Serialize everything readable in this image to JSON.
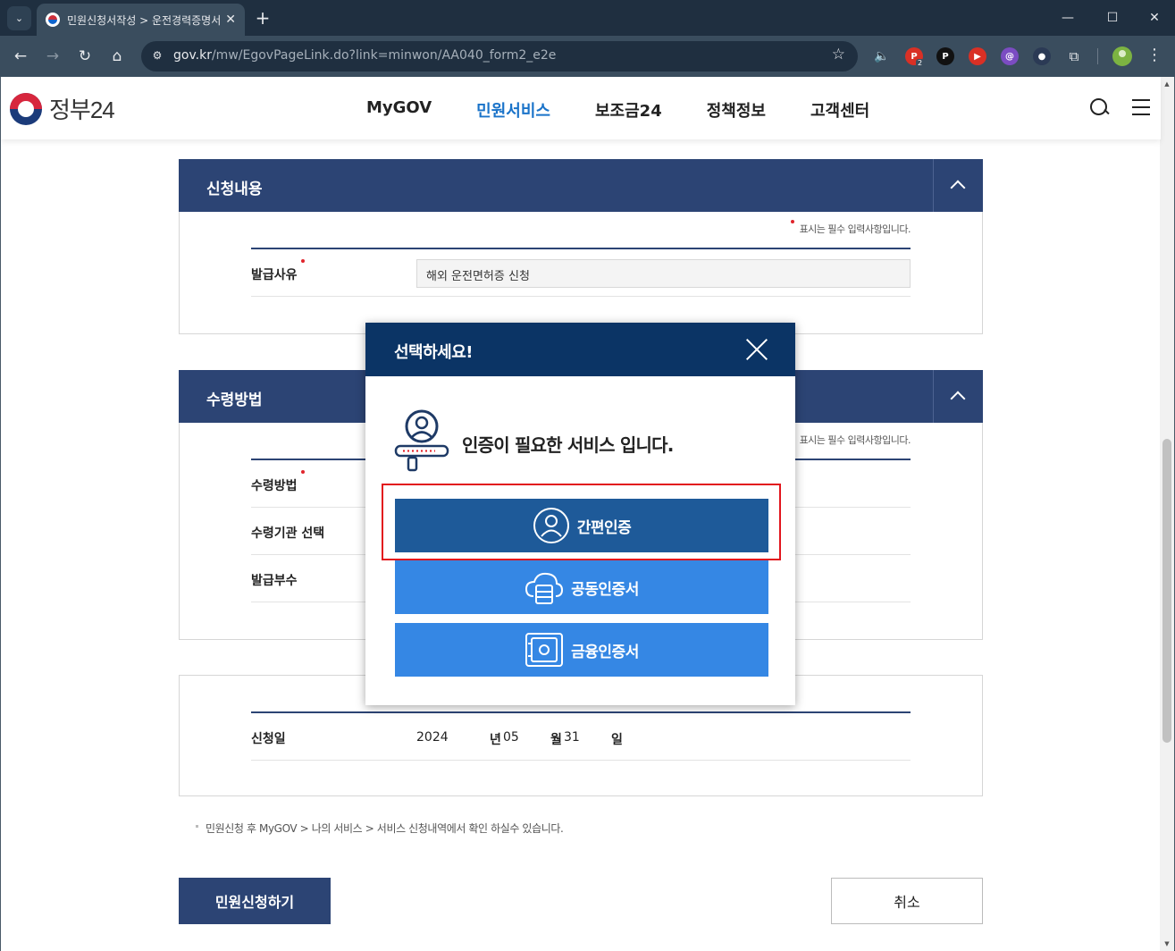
{
  "browser": {
    "tab_title": "민원신청서작성 > 운전경력증명서",
    "url_domain": "gov.kr",
    "url_path": "/mw/EgovPageLink.do?link=minwon/AA040_form2_e2e",
    "extensions": [
      {
        "name": "ext-p-icon",
        "letter": "P",
        "color": "#d93025",
        "badge": "2"
      },
      {
        "name": "ext-pocket-icon",
        "letter": "P",
        "color": "#111111",
        "badge": ""
      },
      {
        "name": "ext-youtube-icon",
        "letter": "▶",
        "color": "#d93025",
        "badge": ""
      },
      {
        "name": "ext-purple-icon",
        "letter": "@",
        "color": "#7b4cc2",
        "badge": ""
      },
      {
        "name": "ext-color-icon",
        "letter": "●",
        "color": "#2b3a55",
        "badge": ""
      }
    ]
  },
  "header": {
    "logo_text": "정부24",
    "nav": [
      "MyGOV",
      "민원서비스",
      "보조금24",
      "정책정보",
      "고객센터"
    ],
    "active_nav": "민원서비스"
  },
  "section1": {
    "title": "신청내용",
    "required_note": "표시는 필수 입력사항입니다.",
    "reason_label": "발급사유",
    "reason_value": "해외 운전면허증 신청"
  },
  "section2": {
    "title": "수령방법",
    "required_note": "표시는 필수 입력사항입니다.",
    "rows": [
      "수령방법",
      "수령기관 선택",
      "발급부수"
    ]
  },
  "date_section": {
    "label": "신청일",
    "year": "2024",
    "year_unit": "년",
    "month": "05",
    "month_unit": "월",
    "day": "31",
    "day_unit": "일"
  },
  "notice": "민원신청 후 MyGOV > 나의 서비스 > 서비스 신청내역에서 확인 하실수 있습니다.",
  "buttons": {
    "submit": "민원신청하기",
    "cancel": "취소"
  },
  "modal": {
    "title": "선택하세요!",
    "message": "인증이 필요한 서비스 입니다.",
    "options": {
      "simple": "간편인증",
      "joint": "공동인증서",
      "finance": "금융인증서"
    }
  },
  "colors": {
    "primary_navy": "#2c4474",
    "modal_header": "#0b3465",
    "simple_auth": "#1e5a99",
    "cert_blue": "#3587e4",
    "highlight_red": "#e2161d",
    "active_nav": "#1a73c9"
  }
}
